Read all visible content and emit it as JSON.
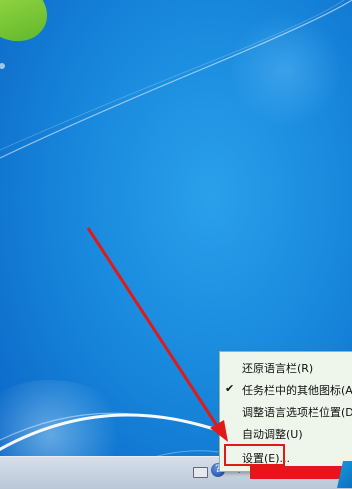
{
  "context_menu": {
    "items": [
      {
        "label": "还原语言栏(R)",
        "checked": false
      },
      {
        "label": "任务栏中的其他图标(A",
        "checked": true
      },
      {
        "label": "调整语言选项栏位置(D",
        "checked": false
      },
      {
        "label": "自动调整(U)",
        "checked": false
      },
      {
        "label": "设置(E)...",
        "checked": false
      }
    ],
    "check_glyph": "✔"
  },
  "tray": {
    "help_glyph": "?"
  },
  "colors": {
    "desktop_blue": "#1888dc",
    "menu_bg": "#eef6ec",
    "annotation_red": "#e01919"
  }
}
